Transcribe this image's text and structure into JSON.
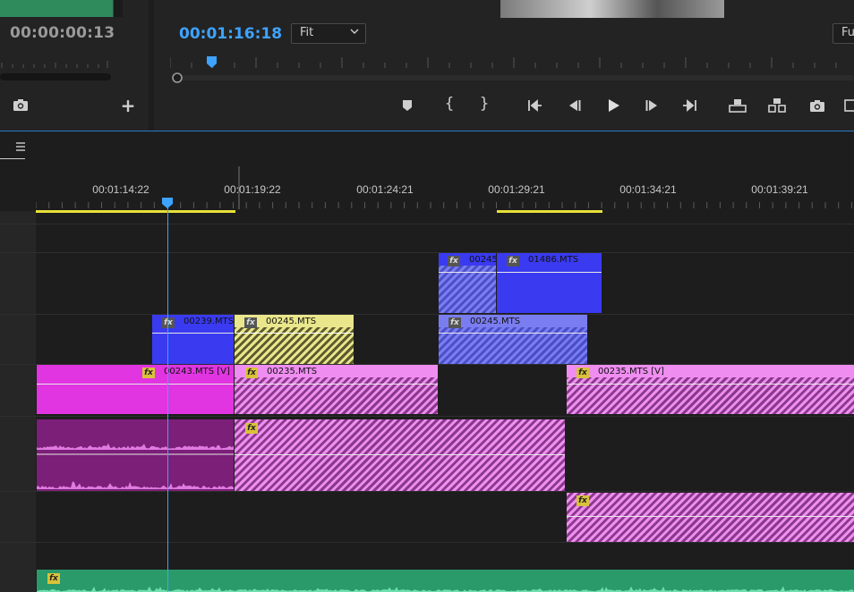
{
  "source_monitor": {
    "timecode": "00:00:00:13",
    "camera_icon": "camera-icon",
    "add_icon": "plus-icon"
  },
  "program_monitor": {
    "timecode": "00:01:16:18",
    "fit_select": {
      "value": "Fit",
      "icon": "chevron-down-icon"
    },
    "full_select": {
      "value": "Fu"
    },
    "transport": [
      {
        "name": "add-marker-button",
        "icon": "marker-icon"
      },
      {
        "name": "mark-in-button",
        "icon": "mark-in-icon",
        "glyph": "{"
      },
      {
        "name": "mark-out-button",
        "icon": "mark-out-icon",
        "glyph": "}"
      },
      {
        "name": "go-to-in-button",
        "icon": "go-to-in-icon"
      },
      {
        "name": "step-back-button",
        "icon": "step-back-icon"
      },
      {
        "name": "play-button",
        "icon": "play-icon"
      },
      {
        "name": "step-forward-button",
        "icon": "step-forward-icon"
      },
      {
        "name": "go-to-out-button",
        "icon": "go-to-out-icon"
      },
      {
        "name": "lift-button",
        "icon": "lift-icon"
      },
      {
        "name": "extract-button",
        "icon": "extract-icon"
      },
      {
        "name": "export-frame-button",
        "icon": "camera-icon"
      }
    ]
  },
  "timeline": {
    "ruler_labels": [
      "00:01:14:22",
      "00:01:19:22",
      "00:01:24:21",
      "00:01:29:21",
      "00:01:34:21",
      "00:01:39:21"
    ],
    "clips": {
      "v3_a": "00245",
      "v3_b": "01486.MTS",
      "v2_a": "00239.MTS",
      "v2_b": "00245.MTS",
      "v2_c": "00245.MTS",
      "v1_a": "00243.MTS [V]",
      "v1_b": "00235.MTS",
      "v1_c": "00235.MTS [V]"
    },
    "fx_label": "fx"
  },
  "colors": {
    "accent": "#3ea3ff",
    "clip_blue": "#3a3af0",
    "clip_magenta": "#e035e0",
    "clip_yellow": "#e9e68c",
    "audio_green": "#2a9a6a",
    "work_area": "#e8e03a"
  }
}
